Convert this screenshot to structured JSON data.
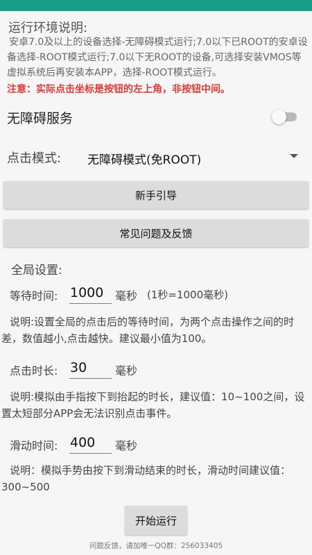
{
  "colors": {
    "status_bar": "#189d89",
    "warning": "#e53935",
    "button_bg": "#dcdcdc"
  },
  "environment": {
    "title": "运行环境说明:",
    "description": "安卓7.0及以上的设备选择-无障碍模式运行;7.0以下已ROOT的安卓设备选择-ROOT模式运行;7.0以下无ROOT的设备,可选择安装VMOS等虚拟系统后再安装本APP，选择-ROOT模式运行。",
    "warning": "注意：实际点击坐标是按钮的左上角，非按钮中间。"
  },
  "accessibility": {
    "label": "无障碍服务",
    "enabled": false
  },
  "click_mode": {
    "label": "点击模式:",
    "selected": "无障碍模式(免ROOT)"
  },
  "buttons": {
    "guide": "新手引导",
    "faq": "常见问题及反馈",
    "start": "开始运行"
  },
  "global_settings": {
    "title": "全局设置:",
    "wait_time": {
      "label": "等待时间:",
      "value": "1000",
      "unit": "毫秒",
      "note": "(1秒=1000毫秒)",
      "description": "说明:设置全局的点击后的等待时间，为两个点击操作之间的时差，数值越小,点击越快。建议最小值为100。"
    },
    "click_duration": {
      "label": "点击时长:",
      "value": "30",
      "unit": "毫秒",
      "description": "说明:模拟由手指按下到抬起的时长，建议值：10~100之间，设置太短部分APP会无法识别点击事件。"
    },
    "slide_time": {
      "label": "滑动时间:",
      "value": "400",
      "unit": "毫秒",
      "description": "说明：模拟手势由按下到滑动结束的时长，滑动时间建议值：300~500"
    }
  },
  "footer": "问题反馈，请加唯一QQ群：256033405"
}
